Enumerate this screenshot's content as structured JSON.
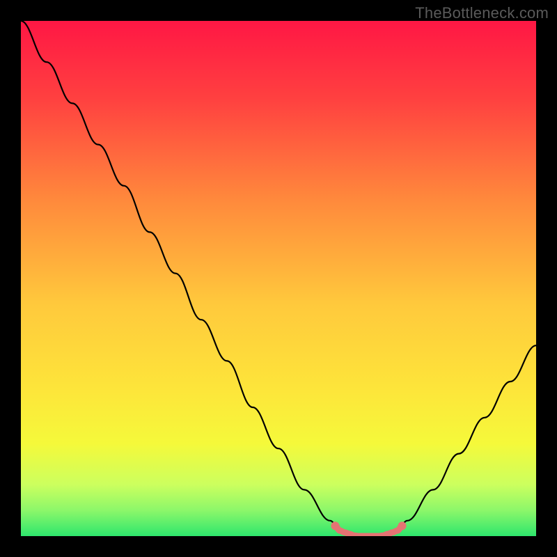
{
  "watermark": "TheBottleneck.com",
  "chart_data": {
    "type": "line",
    "title": "",
    "xlabel": "",
    "ylabel": "",
    "xlim": [
      0,
      100
    ],
    "ylim": [
      0,
      100
    ],
    "series": [
      {
        "name": "bottleneck-curve",
        "x": [
          0,
          5,
          10,
          15,
          20,
          25,
          30,
          35,
          40,
          45,
          50,
          55,
          60,
          62,
          65,
          70,
          73,
          75,
          80,
          85,
          90,
          95,
          100
        ],
        "values": [
          100,
          92,
          84,
          76,
          68,
          59,
          51,
          42,
          34,
          25,
          17,
          9,
          3,
          1,
          0,
          0,
          1,
          3,
          9,
          16,
          23,
          30,
          37
        ]
      }
    ],
    "highlight_region": {
      "x_start": 61,
      "x_end": 74,
      "color": "#e57373"
    },
    "background_gradient": {
      "stops": [
        {
          "offset": 0.0,
          "color": "#ff1744"
        },
        {
          "offset": 0.15,
          "color": "#ff4040"
        },
        {
          "offset": 0.35,
          "color": "#ff8a3c"
        },
        {
          "offset": 0.55,
          "color": "#ffc93c"
        },
        {
          "offset": 0.72,
          "color": "#fde63a"
        },
        {
          "offset": 0.82,
          "color": "#f5f93a"
        },
        {
          "offset": 0.9,
          "color": "#ccff5e"
        },
        {
          "offset": 0.95,
          "color": "#8cf76a"
        },
        {
          "offset": 1.0,
          "color": "#2ee66d"
        }
      ]
    }
  }
}
